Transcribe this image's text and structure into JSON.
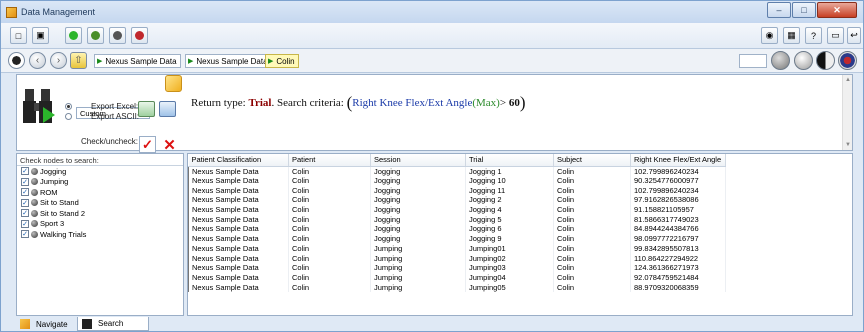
{
  "window": {
    "title": "Data Management"
  },
  "breadcrumbs": [
    "Nexus Sample Data",
    "Nexus Sample Data",
    "Colin"
  ],
  "search": {
    "preset": "Custom",
    "export_excel_label": "Export Excel:",
    "export_ascii_label": "Export ASCII:",
    "check_uncheck_label": "Check/uncheck:",
    "return_type_prefix": "Return type:",
    "return_type_value": "Trial",
    "criteria_prefix": ". Search criteria:",
    "criteria_field": "Right Knee Flex/Ext Angle",
    "criteria_func": "(Max)",
    "criteria_op": ">",
    "criteria_value": "60"
  },
  "nodes": {
    "header": "Check nodes to search:",
    "items": [
      "Jogging",
      "Jumping",
      "ROM",
      "Sit to Stand",
      "Sit to Stand 2",
      "Sport 3",
      "Walking Trials"
    ]
  },
  "table": {
    "columns": [
      "Patient Classification",
      "Patient",
      "Session",
      "Trial",
      "Subject",
      "Right Knee Flex/Ext Angle"
    ],
    "rows": [
      [
        "Nexus Sample Data",
        "Colin",
        "Jogging",
        "Jogging 1",
        "Colin",
        "102.799896240234"
      ],
      [
        "Nexus Sample Data",
        "Colin",
        "Jogging",
        "Jogging 10",
        "Colin",
        "90.3254776000977"
      ],
      [
        "Nexus Sample Data",
        "Colin",
        "Jogging",
        "Jogging 11",
        "Colin",
        "102.799896240234"
      ],
      [
        "Nexus Sample Data",
        "Colin",
        "Jogging",
        "Jogging 2",
        "Colin",
        "97.9162826538086"
      ],
      [
        "Nexus Sample Data",
        "Colin",
        "Jogging",
        "Jogging 4",
        "Colin",
        "91.158821105957"
      ],
      [
        "Nexus Sample Data",
        "Colin",
        "Jogging",
        "Jogging 5",
        "Colin",
        "81.5866317749023"
      ],
      [
        "Nexus Sample Data",
        "Colin",
        "Jogging",
        "Jogging 6",
        "Colin",
        "84.8944244384766"
      ],
      [
        "Nexus Sample Data",
        "Colin",
        "Jogging",
        "Jogging 9",
        "Colin",
        "98.0997772216797"
      ],
      [
        "Nexus Sample Data",
        "Colin",
        "Jumping",
        "Jumping01",
        "Colin",
        "99.8342895507813"
      ],
      [
        "Nexus Sample Data",
        "Colin",
        "Jumping",
        "Jumping02",
        "Colin",
        "110.864227294922"
      ],
      [
        "Nexus Sample Data",
        "Colin",
        "Jumping",
        "Jumping03",
        "Colin",
        "124.361366271973"
      ],
      [
        "Nexus Sample Data",
        "Colin",
        "Jumping",
        "Jumping04",
        "Colin",
        "92.0784759521484"
      ],
      [
        "Nexus Sample Data",
        "Colin",
        "Jumping",
        "Jumping05",
        "Colin",
        "88.9709320068359"
      ]
    ]
  },
  "tabs": [
    "Navigate",
    "Search"
  ],
  "colors": {
    "accent": "#1a3aa8",
    "trial": "#8b0000",
    "func": "#2a8a2a",
    "current_crumb": "#fff9b8"
  }
}
